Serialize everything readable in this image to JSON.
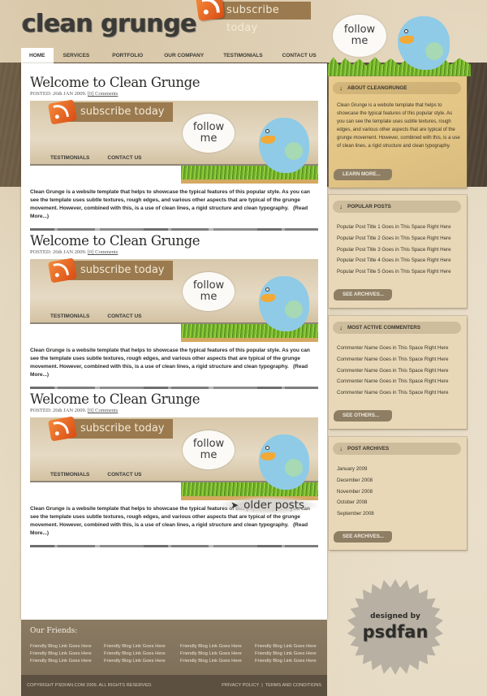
{
  "header": {
    "logo": "clean grunge",
    "subscribe_label": "subscribe today",
    "follow_line1": "follow",
    "follow_line2": "me"
  },
  "nav": {
    "items": [
      {
        "label": "HOME",
        "active": true
      },
      {
        "label": "SERVICES"
      },
      {
        "label": "PORTFOLIO"
      },
      {
        "label": "OUR COMPANY"
      },
      {
        "label": "TESTIMONIALS"
      },
      {
        "label": "CONTACT US"
      }
    ]
  },
  "posts": [
    {
      "title": "Welcome to Clean Grunge",
      "meta_posted": "POSTED: 26th JAN 2009.",
      "meta_comments": "[0] Comments",
      "image": {
        "subscribe": "subscribe today",
        "nav1": "TESTIMONIALS",
        "nav2": "CONTACT US",
        "follow1": "follow",
        "follow2": "me"
      },
      "body": "Clean Grunge is a website template that helps to showcase the typical features of this popular style. As you can see the template uses subtle textures, rough edges, and various other aspects that are typical of the grunge movement. However, combined with this, is a use of clean lines, a rigid structure and clean typography.",
      "read_more": "(Read More...)"
    },
    {
      "title": "Welcome to Clean Grunge",
      "meta_posted": "POSTED: 26th JAN 2009.",
      "meta_comments": "[0] Comments",
      "image": {
        "subscribe": "subscribe today",
        "nav1": "TESTIMONIALS",
        "nav2": "CONTACT US",
        "follow1": "follow",
        "follow2": "me"
      },
      "body": "Clean Grunge is a website template that helps to showcase the typical features of this popular style. As you can see the template uses subtle textures, rough edges, and various other aspects that are typical of the grunge movement. However, combined with this, is a use of clean lines, a rigid structure and clean typography.",
      "read_more": "(Read More...)"
    },
    {
      "title": "Welcome to Clean Grunge",
      "meta_posted": "POSTED: 26th JAN 2009.",
      "meta_comments": "[0] Comments",
      "image": {
        "subscribe": "subscribe today",
        "nav1": "TESTIMONIALS",
        "nav2": "CONTACT US",
        "follow1": "follow",
        "follow2": "me"
      },
      "body": "Clean Grunge is a website template that helps to showcase the typical features of this popular style. As you can see the template uses subtle textures, rough edges, and various other aspects that are typical of the grunge movement. However, combined with this, is a use of clean lines, a rigid structure and clean typography.",
      "read_more": "(Read More...)"
    }
  ],
  "older_posts": {
    "label": "older posts",
    "icon": "arrow-icon"
  },
  "sidebar": {
    "about": {
      "title": "ABOUT CLEANGRUNGE",
      "text": "Clean Grunge is a website template that helps to showcase the typical features of this popular style. As you can see the template uses subtle textures, rough edges, and various other aspects that are typical of the grunge movement. However, combined with this, is a use of clean lines, a rigid structure and clean typography.",
      "button": "LEARN MORE..."
    },
    "popular": {
      "title": "POPULAR POSTS",
      "items": [
        "Popular Post Title 1 Goes in This Space Right Here",
        "Popular Post Title 2 Goes in This Space Right Here",
        "Popular Post Title 3 Goes in This Space Right Here",
        "Popular Post Title 4 Goes in This Space Right Here",
        "Popular Post Title 5 Goes in This Space Right Here"
      ],
      "button": "SEE ARCHIVES..."
    },
    "commenters": {
      "title": "MOST ACTIVE COMMENTERS",
      "items": [
        "Commenter Name Goes in This Space Right Here",
        "Commenter Name Goes in This Space Right Here",
        "Commenter Name Goes in This Space Right Here",
        "Commenter Name Goes in This Space Right Here",
        "Commenter Name Goes in This Space Right Here"
      ],
      "button": "SEE OTHERS..."
    },
    "archives": {
      "title": "POST ARCHIVES",
      "items": [
        "January 2009",
        "December 2008",
        "November 2008",
        "October 2008",
        "September 2008"
      ],
      "button": "SEE ARCHIVES..."
    },
    "arrow_glyph": "↓"
  },
  "footer": {
    "friends_title": "Our Friends:",
    "friend_link": "Friendly Blog Link Goes Here",
    "copyright": "COPYRIGHT PSDFAN.COM 2009. ALL RIGHTS RESERVED.",
    "privacy": "PRIVACY POLICY",
    "separator": "|",
    "terms": "TERMS AND CONDITIONS"
  },
  "badge": {
    "small": "designed by",
    "big": "psdfan"
  },
  "colors": {
    "accent_orange": "#e0621f",
    "brown_dark": "#5c5041",
    "sidebar_tan": "#e8d8b8",
    "about_gold": "#e6c98a"
  }
}
